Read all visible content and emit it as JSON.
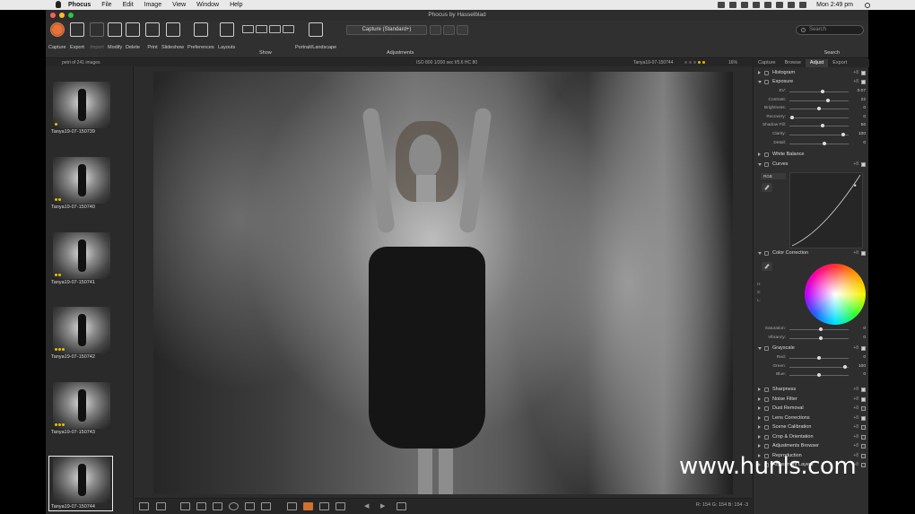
{
  "menubar": {
    "menus": [
      "Phocus",
      "File",
      "Edit",
      "Image",
      "View",
      "Window",
      "Help"
    ],
    "clock": "Mon 2:49 pm"
  },
  "window": {
    "title": "Phocus by Hasselblad"
  },
  "toolbar": {
    "buttons": [
      "Capture",
      "Export",
      "Import",
      "Modify",
      "Delete",
      "Print",
      "Slideshow",
      "Preferences",
      "Layouts"
    ],
    "show_label": "Show",
    "portrait_label": "Portrait/Landscape",
    "capture_preset": "Capture (Standard+)",
    "adjustments_label": "Adjustments",
    "search_placeholder": "Search",
    "search_label": "Search",
    "capture_color": "#e8733a"
  },
  "infobar": {
    "count": "petri of 241 images",
    "meta": "ISO 800  1/200 sec  f/5.6  HC 80",
    "filename": "Tanya19-07-150744",
    "zoom": "16%"
  },
  "thumbnails": [
    {
      "name": "Tanya19-07-150739",
      "stars": 1
    },
    {
      "name": "Tanya19-07-150740",
      "stars": 2
    },
    {
      "name": "Tanya19-07-150741",
      "stars": 2
    },
    {
      "name": "Tanya19-07-150742",
      "stars": 3
    },
    {
      "name": "Tanya19-07-150743",
      "stars": 3
    },
    {
      "name": "Tanya19-07-150744",
      "stars": 0
    }
  ],
  "viewer": {
    "pixel_readout": "R: 154  G: 154  B: 154  -3"
  },
  "panel": {
    "tabs": [
      "Capture",
      "Browse",
      "Adjust",
      "Export"
    ],
    "active_tab": "Adjust",
    "histogram": "Histogram",
    "exposure": "Exposure",
    "exposure_sliders": [
      {
        "label": "EV:",
        "value": "0.07",
        "pos": 0.57
      },
      {
        "label": "Contrast:",
        "value": "22",
        "pos": 0.66
      },
      {
        "label": "Brightness:",
        "value": "0",
        "pos": 0.5
      },
      {
        "label": "Recovery:",
        "value": "0",
        "pos": 0.02
      },
      {
        "label": "Shadow Fill:",
        "value": "56",
        "pos": 0.56
      },
      {
        "label": "Clarity:",
        "value": "100",
        "pos": 0.93
      },
      {
        "label": "Detail:",
        "value": "0",
        "pos": 0.6
      }
    ],
    "white_balance": "White Balance",
    "curves": "Curves",
    "curves_channel": "RGB",
    "color_correction": "Color Correction",
    "cc_sliders": [
      {
        "label": "Saturation:",
        "value": "0",
        "pos": 0.54
      },
      {
        "label": "Vibrancy:",
        "value": "0",
        "pos": 0.54
      }
    ],
    "grayscale": "Grayscale",
    "gray_sliders": [
      {
        "label": "Red:",
        "value": "0",
        "pos": 0.5
      },
      {
        "label": "Green:",
        "value": "100",
        "pos": 0.96
      },
      {
        "label": "Blue:",
        "value": "0",
        "pos": 0.5
      }
    ],
    "tools": [
      {
        "label": "Sharpness",
        "checked": true
      },
      {
        "label": "Noise Filter",
        "checked": true
      },
      {
        "label": "Dust Removal",
        "checked": false
      },
      {
        "label": "Lens Corrections",
        "checked": true
      },
      {
        "label": "Scene Calibration",
        "checked": false
      },
      {
        "label": "Crop & Orientation",
        "checked": false
      },
      {
        "label": "Adjustments Browser",
        "checked": false
      },
      {
        "label": "Reproduction",
        "checked": false
      },
      {
        "label": "Adjustment Layers",
        "checked": false
      }
    ],
    "tool_menu": "+8"
  },
  "watermark": "www.hunls.com"
}
